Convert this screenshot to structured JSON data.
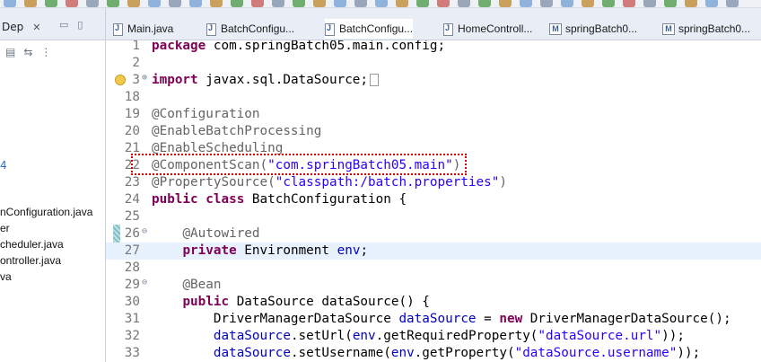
{
  "left_panel": {
    "tab_label": "Dep",
    "tab_close": "✕",
    "tree_items": [
      {
        "text": "4",
        "kind": "num"
      },
      {
        "text": "nConfiguration.java"
      },
      {
        "text": "er"
      },
      {
        "text": "cheduler.java"
      },
      {
        "text": "ontroller.java"
      },
      {
        "text": "va"
      }
    ]
  },
  "editor_tabs": [
    {
      "label": "Main.java",
      "icon": "java-file-icon"
    },
    {
      "label": "BatchConfigu...",
      "icon": "java-file-icon"
    },
    {
      "label": "BatchConfigu...",
      "icon": "java-file-icon",
      "active": true
    },
    {
      "label": "HomeControll...",
      "icon": "java-file-icon"
    },
    {
      "label": "springBatch0...",
      "icon": "maven-file-icon"
    },
    {
      "label": "springBatch0...",
      "icon": "maven-file-icon"
    }
  ],
  "code_lines": [
    {
      "n": "1",
      "parts": [
        [
          "kw",
          "package"
        ],
        [
          "",
          "com.springBatch05.main.config;"
        ]
      ]
    },
    {
      "n": "2",
      "parts": []
    },
    {
      "n": "3",
      "fold": "⊕",
      "warn": true,
      "parts": [
        [
          "kw",
          "import"
        ],
        [
          "",
          "javax.sql.DataSource;"
        ]
      ],
      "collapsed": true
    },
    {
      "n": "18",
      "parts": []
    },
    {
      "n": "19",
      "parts": [
        [
          "ann",
          "@Configuration"
        ]
      ]
    },
    {
      "n": "20",
      "parts": [
        [
          "ann",
          "@EnableBatchProcessing"
        ]
      ]
    },
    {
      "n": "21",
      "parts": [
        [
          "ann",
          "@EnableScheduling"
        ]
      ]
    },
    {
      "n": "22",
      "parts": [
        [
          "ann",
          "@ComponentScan("
        ],
        [
          "str",
          "\"com.springBatch05.main\""
        ],
        [
          "ann",
          ")"
        ]
      ]
    },
    {
      "n": "23",
      "parts": [
        [
          "ann",
          "@PropertySource("
        ],
        [
          "str",
          "\"classpath:/batch.properties\""
        ],
        [
          "ann",
          ")"
        ]
      ]
    },
    {
      "n": "24",
      "parts": [
        [
          "kw",
          "public"
        ],
        [
          "",
          " "
        ],
        [
          "kw",
          "class"
        ],
        [
          "",
          " BatchConfiguration {"
        ]
      ]
    },
    {
      "n": "25",
      "parts": []
    },
    {
      "n": "26",
      "fold": "⊖",
      "parts": [
        [
          "",
          "    "
        ],
        [
          "ann",
          "@Autowired"
        ]
      ]
    },
    {
      "n": "27",
      "current": true,
      "parts": [
        [
          "",
          "    "
        ],
        [
          "kw",
          "private"
        ],
        [
          "",
          " Environment "
        ],
        [
          "fld",
          "env"
        ],
        [
          "",
          ";"
        ]
      ]
    },
    {
      "n": "28",
      "parts": []
    },
    {
      "n": "29",
      "fold": "⊖",
      "parts": [
        [
          "",
          "    "
        ],
        [
          "ann",
          "@Bean"
        ]
      ]
    },
    {
      "n": "30",
      "parts": [
        [
          "",
          "    "
        ],
        [
          "kw",
          "public"
        ],
        [
          "",
          " DataSource dataSource() {"
        ]
      ]
    },
    {
      "n": "31",
      "parts": [
        [
          "",
          "        DriverManagerDataSource "
        ],
        [
          "fld",
          "dataSource"
        ],
        [
          "",
          " = "
        ],
        [
          "kw",
          "new"
        ],
        [
          "",
          " DriverManagerDataSource();"
        ]
      ]
    },
    {
      "n": "32",
      "parts": [
        [
          "",
          "        "
        ],
        [
          "fld",
          "dataSource"
        ],
        [
          "",
          ".setUrl("
        ],
        [
          "fld",
          "env"
        ],
        [
          "",
          ".getRequiredProperty("
        ],
        [
          "str",
          "\"dataSource.url\""
        ],
        [
          "",
          "));"
        ]
      ]
    },
    {
      "n": "33",
      "parts": [
        [
          "",
          "        "
        ],
        [
          "fld",
          "dataSource"
        ],
        [
          "",
          ".setUsername("
        ],
        [
          "fld",
          "env"
        ],
        [
          "",
          ".getProperty("
        ],
        [
          "str",
          "\"dataSource.username\""
        ],
        [
          "",
          "));"
        ]
      ]
    }
  ],
  "colors": {
    "keyword": "#7f0055",
    "annotation": "#646464",
    "string": "#2a00ff",
    "field": "#0000c0",
    "highlight_border": "#d40000"
  }
}
